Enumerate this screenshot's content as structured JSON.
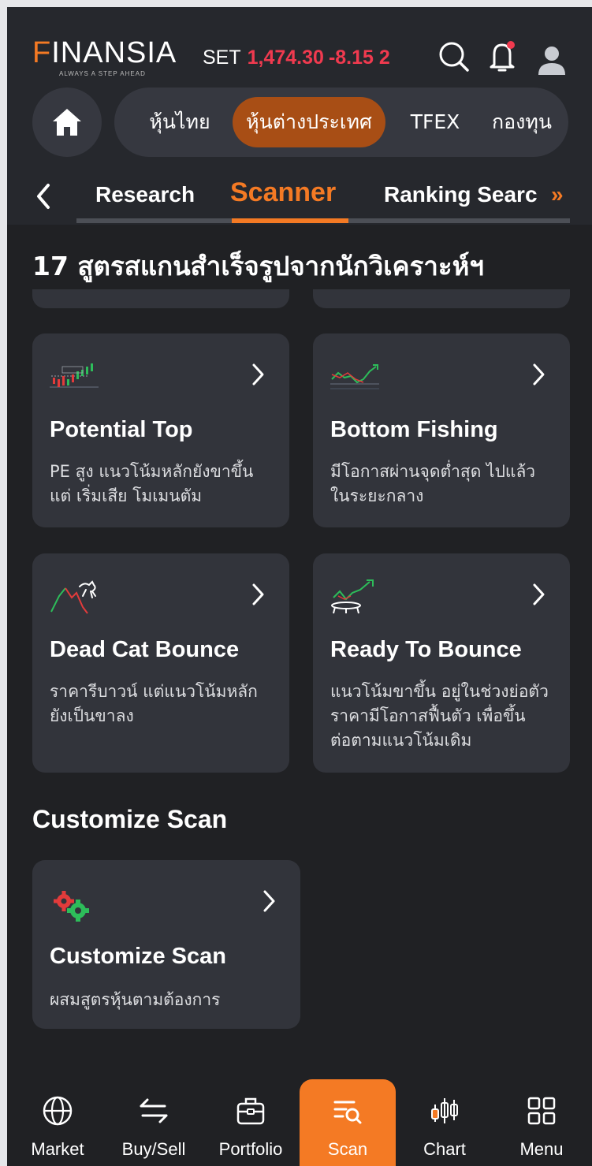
{
  "header": {
    "brand": "INANSIA",
    "brand_initial": "F",
    "tagline": "ALWAYS A STEP AHEAD",
    "index_label": "SET",
    "index_value": "1,474.30",
    "index_change": "-8.15 2",
    "search_icon": "search-icon",
    "notification_icon": "bell-icon",
    "profile_icon": "user-icon"
  },
  "market_tabs": [
    {
      "label": "หุ้นไทย"
    },
    {
      "label": "หุ้นต่างประเทศ",
      "active": true
    },
    {
      "label": "TFEX"
    },
    {
      "label": "กองทุน"
    }
  ],
  "sub_tabs": [
    {
      "label": "Research"
    },
    {
      "label": "Scanner",
      "active": true
    },
    {
      "label": "Ranking Searc"
    }
  ],
  "more_glyph": "»",
  "section_title": "17 สูตรสแกนสำเร็จรูปจากนักวิเคราะห์ฯ",
  "cards": [
    {
      "title": "Potential Top",
      "desc": "PE สูง แนวโน้มหลักยังขาขึ้น แต่ เริ่มเสีย โมเมนตัม",
      "icon": "chart-top-icon"
    },
    {
      "title": "Bottom Fishing",
      "desc": "มีโอกาสผ่านจุดต่ำสุด ไปแล้ว ในระยะกลาง",
      "icon": "chart-bottom-icon"
    },
    {
      "title": "Dead Cat Bounce",
      "desc": "ราคารีบาวน์ แต่แนวโน้มหลัก ยังเป็นขาลง",
      "icon": "cat-chart-icon"
    },
    {
      "title": "Ready To Bounce",
      "desc": "แนวโน้มขาขึ้น อยู่ในช่วงย่อตัว ราคามีโอกาสฟื้นตัว เพื่อขึ้นต่อตามแนวโน้มเดิม",
      "icon": "trampoline-icon"
    }
  ],
  "customize": {
    "section_title": "Customize Scan",
    "card_title": "Customize Scan",
    "card_desc": "ผสมสูตรหุ้นตามต้องการ",
    "icon": "gears-icon"
  },
  "bottom_nav": [
    {
      "label": "Market",
      "icon": "globe-icon"
    },
    {
      "label": "Buy/Sell",
      "icon": "swap-icon"
    },
    {
      "label": "Portfolio",
      "icon": "briefcase-icon"
    },
    {
      "label": "Scan",
      "icon": "scan-icon",
      "active": true
    },
    {
      "label": "Chart",
      "icon": "candlestick-icon"
    },
    {
      "label": "Menu",
      "icon": "grid-icon"
    }
  ],
  "colors": {
    "accent": "#f47a24",
    "negative": "#f03a4f",
    "background": "#202124",
    "card": "#32343b"
  }
}
